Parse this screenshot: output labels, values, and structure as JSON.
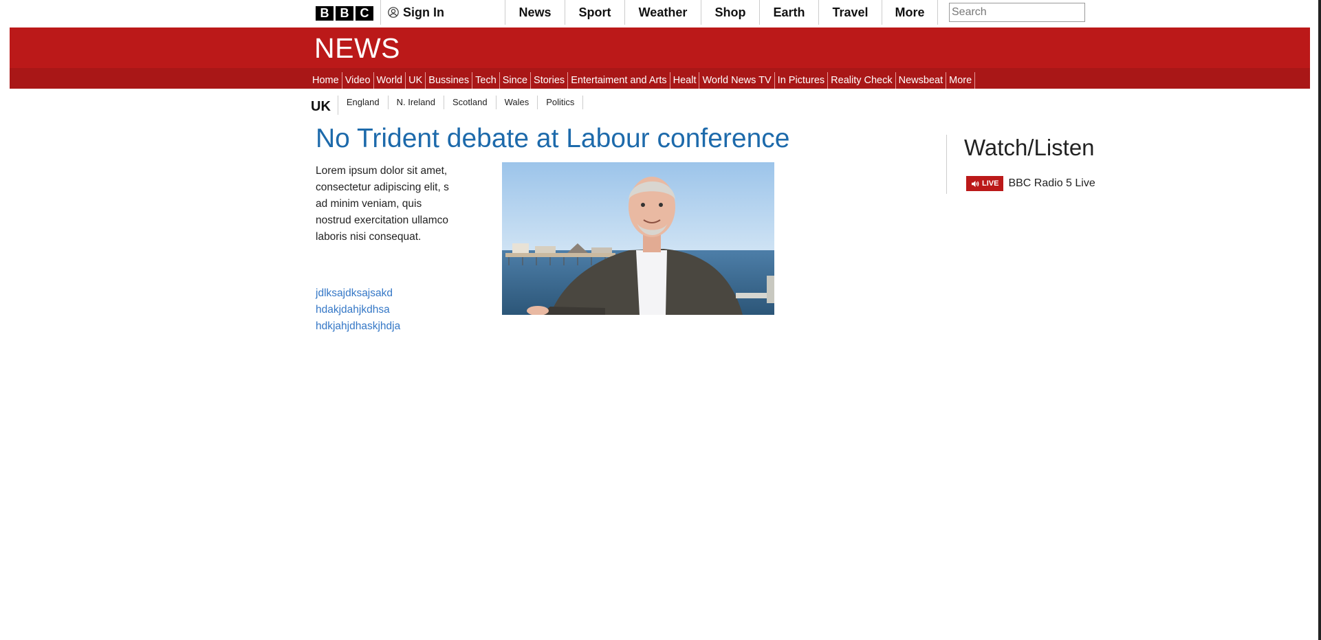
{
  "header": {
    "logo_letters": [
      "B",
      "B",
      "C"
    ],
    "sign_in": "Sign In",
    "nav": [
      "News",
      "Sport",
      "Weather",
      "Shop",
      "Earth",
      "Travel",
      "More"
    ],
    "search_placeholder": "Search"
  },
  "news_band": {
    "title": "NEWS",
    "nav": [
      "Home",
      "Video",
      "World",
      "UK",
      "Bussines",
      "Tech",
      "Since",
      "Stories",
      "Entertaiment and Arts",
      "Healt",
      "World News TV",
      "In Pictures",
      "Reality Check",
      "Newsbeat",
      "More"
    ]
  },
  "subnav": {
    "section": "UK",
    "items": [
      "England",
      "N. Ireland",
      "Scotland",
      "Wales",
      "Politics"
    ]
  },
  "article": {
    "headline": "No Trident debate at Labour conference",
    "summary": "Lorem ipsum dolor sit amet, consectetur adipiscing elit, s ad minim veniam, quis nostrud exercitation ullamco laboris nisi consequat.",
    "links": [
      "jdlksajdksajsakd",
      "hdakjdahjkdhsa",
      "hdkjahjdhaskjhdja"
    ]
  },
  "watch_listen": {
    "title": "Watch/Listen",
    "live_badge": "LIVE",
    "station": "BBC Radio 5 Live"
  },
  "colors": {
    "brand_red": "#bb1919",
    "headline_blue": "#1d6aab",
    "link_blue": "#3477c6"
  }
}
